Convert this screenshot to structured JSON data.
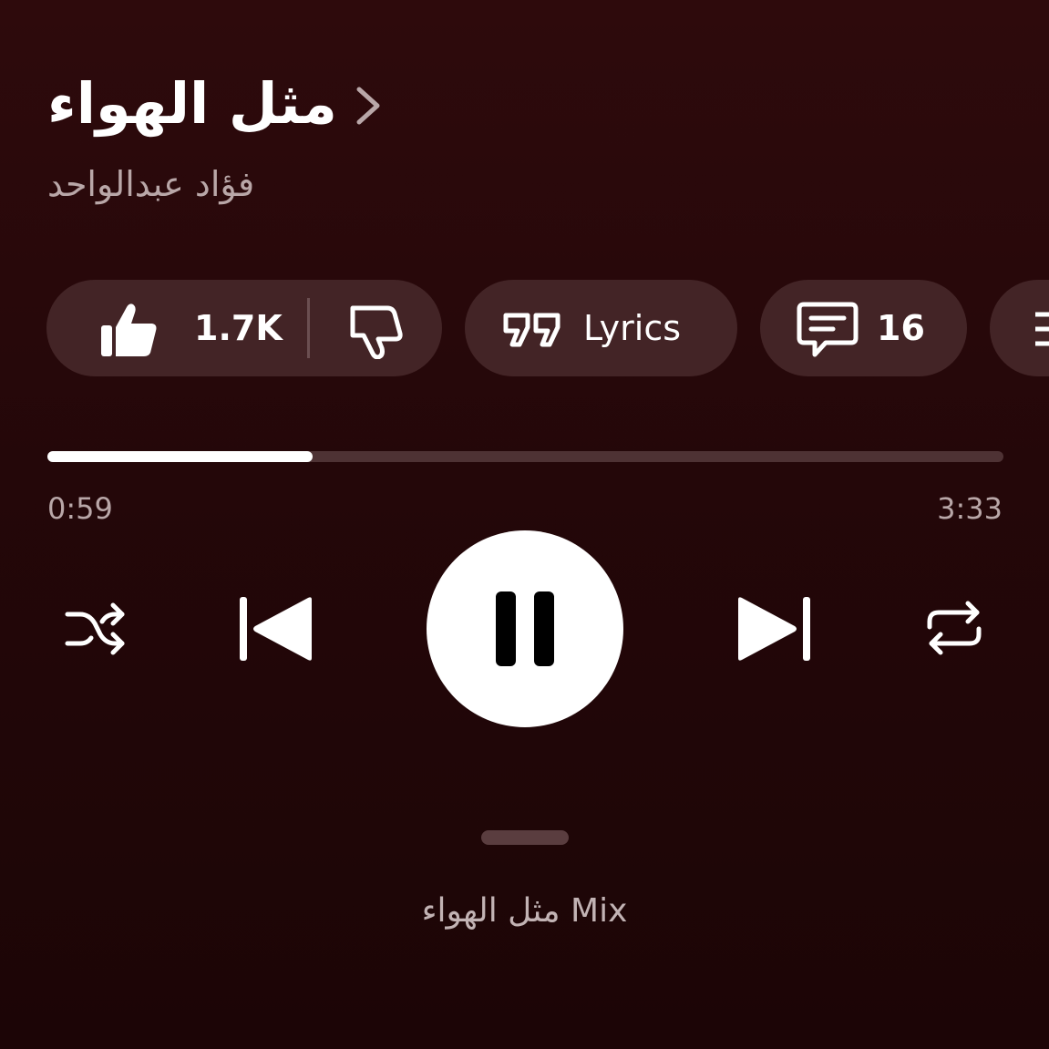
{
  "track": {
    "title": "مثل الهواء",
    "artist": "فؤاد عبدالواحد"
  },
  "actions": {
    "like_count": "1.7K",
    "lyrics_label": "Lyrics",
    "comments_count": "16"
  },
  "progress": {
    "elapsed": "0:59",
    "duration": "3:33",
    "fraction": 0.277
  },
  "queue": {
    "title": "مثل الهواء Mix"
  },
  "icons": {
    "chevron": "chevron-right-icon",
    "like": "thumbs-up-icon",
    "dislike": "thumbs-down-icon",
    "lyrics": "quote-icon",
    "comments": "comment-icon",
    "more": "menu-icon",
    "shuffle": "shuffle-icon",
    "previous": "skip-previous-icon",
    "pause": "pause-icon",
    "next": "skip-next-icon",
    "repeat": "repeat-icon"
  },
  "colors": {
    "background": "#2e0a0c",
    "chip": "#432426",
    "track": "#4e3234",
    "fill": "#ffffff",
    "muted_text": "#b9a7a8"
  }
}
